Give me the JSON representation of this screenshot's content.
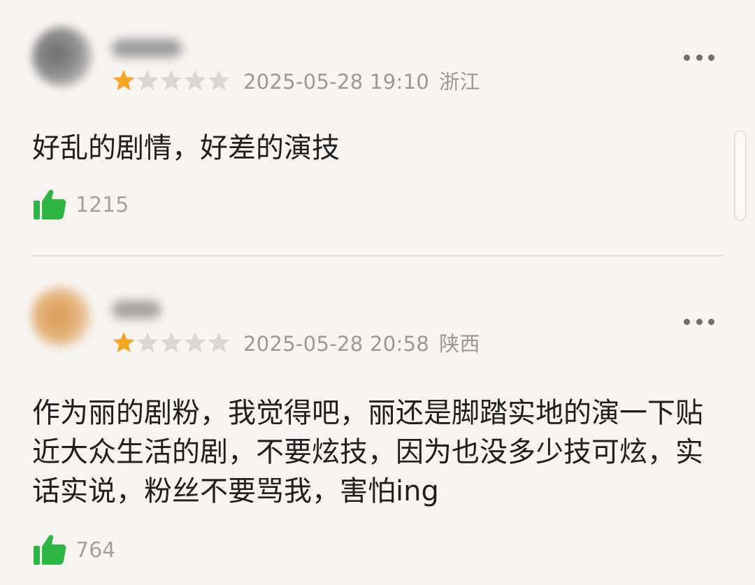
{
  "colors": {
    "background": "#f7f4f2",
    "star_filled": "#f5a623",
    "star_empty": "#d9d6d4",
    "like_icon": "#2fb544",
    "meta_text": "#9a9898",
    "comment_text": "#1f1f1f"
  },
  "comments": [
    {
      "rating": 1,
      "rating_max": 5,
      "date": "2025-05-28 19:10",
      "region": "浙江",
      "text": "好乱的剧情，好差的演技",
      "likes": "1215",
      "icons": {
        "like": "thumbs-up-icon",
        "more": "more-dots-icon",
        "star": "star-icon"
      }
    },
    {
      "rating": 1,
      "rating_max": 5,
      "date": "2025-05-28 20:58",
      "region": "陕西",
      "text": "作为丽的剧粉，我觉得吧，丽还是脚踏实地的演一下贴近大众生活的剧，不要炫技，因为也没多少技可炫，实话实说，粉丝不要骂我，害怕ing",
      "likes": "764",
      "icons": {
        "like": "thumbs-up-icon",
        "more": "more-dots-icon",
        "star": "star-icon"
      }
    }
  ]
}
